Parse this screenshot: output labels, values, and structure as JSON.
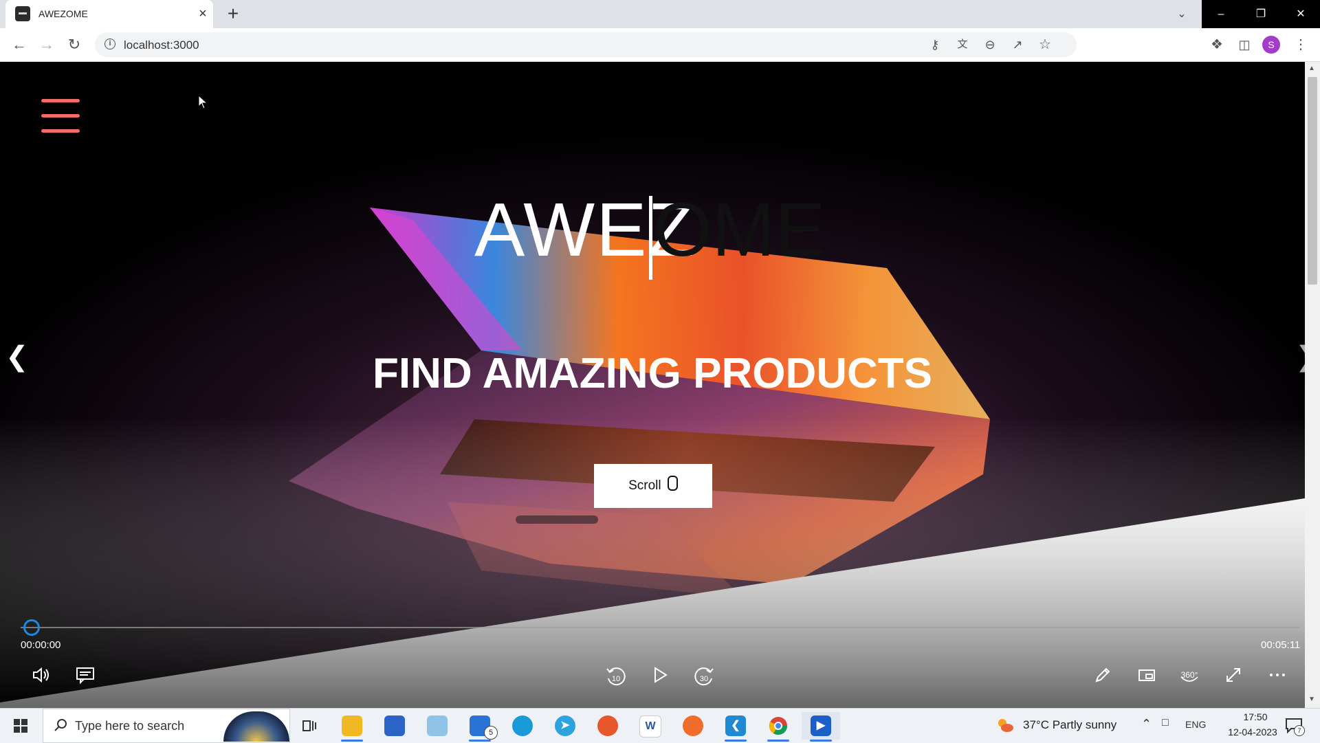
{
  "browser": {
    "tab_title": "AWEZOME",
    "tab_close": "×",
    "new_tab": "+",
    "url": "localhost:3000",
    "profile_initial": "S",
    "window_controls": [
      "–",
      "❐",
      "✕"
    ]
  },
  "page": {
    "brand_typed": "AWEZ",
    "brand_ghost": "OME",
    "heading": "FIND AMAZING PRODUCTS",
    "scroll_button": "Scroll"
  },
  "player": {
    "current_time": "00:00:00",
    "total_time": "00:05:11",
    "progress": 0,
    "rewind_seconds": "10",
    "forward_seconds": "30",
    "view_360": "360°"
  },
  "taskbar": {
    "search_placeholder": "Type here to search",
    "weather": "37°C  Partly sunny",
    "language": "ENG",
    "time": "17:50",
    "date": "12-04-2023",
    "mail_badge": "5",
    "notification_count": "7",
    "apps": [
      "task-view",
      "file-explorer",
      "microsoft-store",
      "notepad",
      "mail",
      "edge",
      "telegram",
      "firefox",
      "word-app",
      "postman",
      "vscode",
      "chrome",
      "media-player"
    ]
  },
  "colors": {
    "hamburger": "#f36b6b",
    "seek_thumb": "#1e88e5",
    "profile": "#a33dc9",
    "taskbar": "#eef1f6"
  }
}
